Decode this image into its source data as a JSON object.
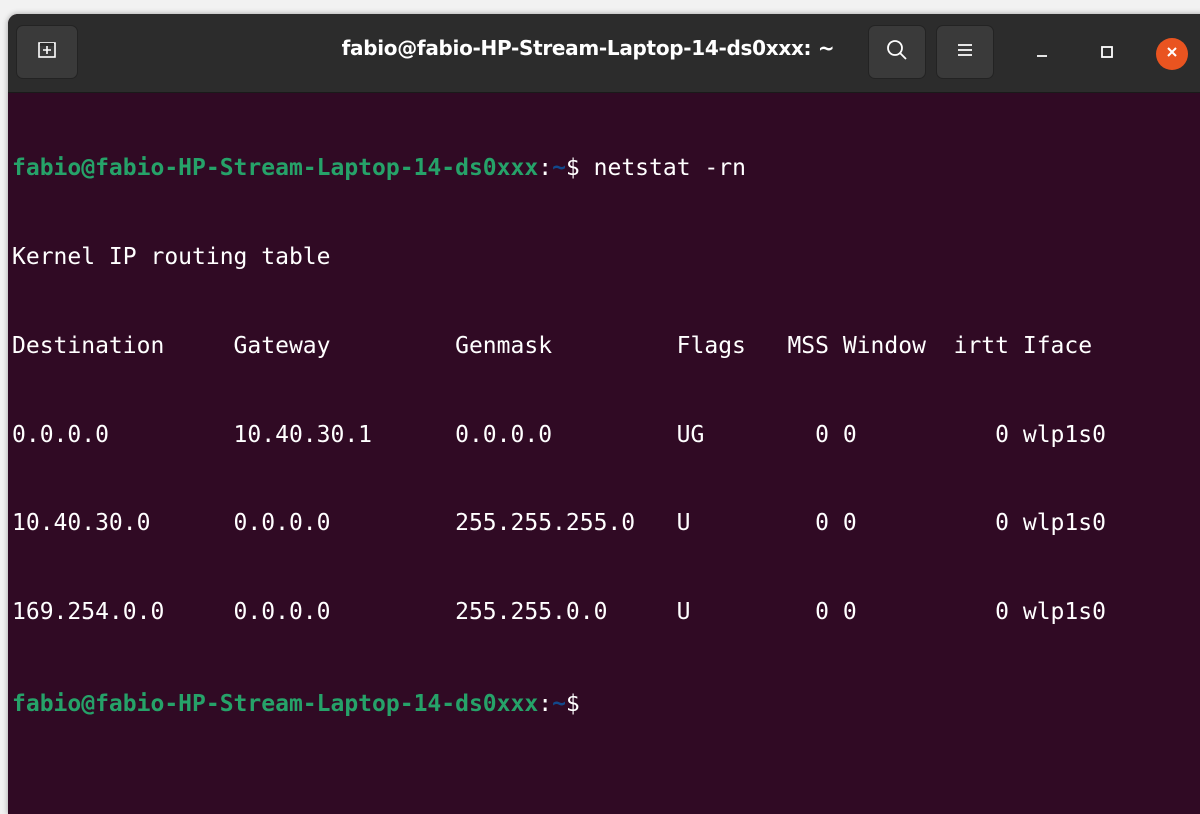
{
  "window": {
    "title": "fabio@fabio-HP-Stream-Laptop-14-ds0xxx: ~"
  },
  "icons": {
    "new_tab": "new-tab-icon",
    "search": "search-icon",
    "menu": "hamburger-menu-icon",
    "minimize": "minimize-icon",
    "maximize": "maximize-icon",
    "close": "close-icon"
  },
  "colors": {
    "terminal_bg": "#300a24",
    "prompt_user": "#26a269",
    "prompt_path": "#12488b",
    "close_button": "#e95420"
  },
  "terminal": {
    "prompt1": {
      "user_host": "fabio@fabio-HP-Stream-Laptop-14-ds0xxx",
      "sep": ":",
      "path": "~",
      "symbol": "$ ",
      "command": "netstat -rn"
    },
    "output": [
      "Kernel IP routing table",
      "Destination     Gateway         Genmask         Flags   MSS Window  irtt Iface",
      "0.0.0.0         10.40.30.1      0.0.0.0         UG        0 0          0 wlp1s0",
      "10.40.30.0      0.0.0.0         255.255.255.0   U         0 0          0 wlp1s0",
      "169.254.0.0     0.0.0.0         255.255.0.0     U         0 0          0 wlp1s0"
    ],
    "prompt2": {
      "user_host": "fabio@fabio-HP-Stream-Laptop-14-ds0xxx",
      "sep": ":",
      "path": "~",
      "symbol": "$ "
    }
  }
}
